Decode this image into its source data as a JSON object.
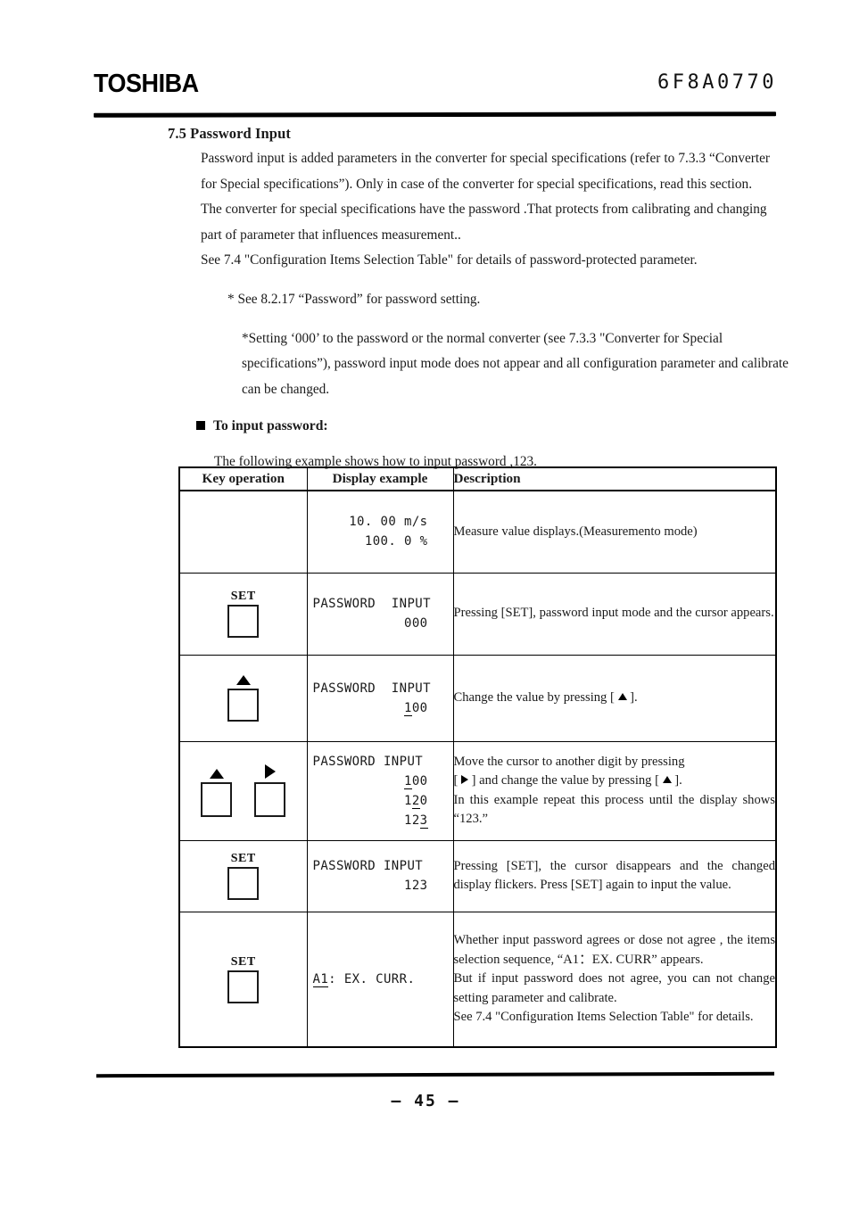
{
  "header": {
    "logo": "TOSHIBA",
    "doc_number": "6F8A0770"
  },
  "section": {
    "title": "7.5 Password Input",
    "paragraphs": [
      "Password input is added parameters in the converter for special specifications (refer to 7.3.3 “Converter for Special specifications”). Only in case of the converter for special specifications, read this section.",
      "The converter for special specifications have the password .That protects from calibrating and changing part of parameter that influences measurement..",
      "See 7.4 \"Configuration Items Selection Table\" for details of password-protected parameter."
    ],
    "notes": [
      "* See 8.2.17 “Password” for password setting.",
      "*Setting ‘000’ to the password or the normal converter (see 7.3.3 \"Converter for Special specifications”), password input mode does not appear and all configuration parameter and calibrate can be changed."
    ],
    "bullet_heading": "To input password:",
    "lead_in": "The following example shows how to input password ,123."
  },
  "table": {
    "headers": {
      "key_operation": "Key operation",
      "display_example": "Display example",
      "description": "Description"
    },
    "rows": [
      {
        "keys": [],
        "display_lines": [
          "10. 00 m/s",
          "100. 0 %"
        ],
        "description": "Measure value displays.(Measuremento mode)"
      },
      {
        "keys": [
          {
            "label": "SET",
            "icon": "set-key"
          }
        ],
        "display_lines": [
          "PASSWORD  INPUT",
          "000"
        ],
        "description": "Pressing [SET], password input mode and the cursor appears."
      },
      {
        "keys": [
          {
            "label": "",
            "icon": "arrow-up-key"
          }
        ],
        "display_lines": [
          "PASSWORD  INPUT",
          "100"
        ],
        "description_parts": [
          "Change the value by pressing [ ",
          " ]."
        ],
        "description": "Change the value by pressing [ ▲ ]."
      },
      {
        "keys": [
          {
            "label": "",
            "icon": "arrow-up-key"
          },
          {
            "label": "",
            "icon": "arrow-right-key"
          }
        ],
        "display_lines": [
          "PASSWORD INPUT",
          "100",
          "120",
          "123"
        ],
        "description": "Move the cursor to another digit by pressing [ ▶ ] and change the value by pressing [ ▲ ]. In this example repeat this process until the display shows “123.”"
      },
      {
        "keys": [
          {
            "label": "SET",
            "icon": "set-key"
          }
        ],
        "display_lines": [
          "PASSWORD INPUT",
          "123"
        ],
        "description": "Pressing [SET], the cursor disappears and the changed display flickers. Press [SET] again to input the value."
      },
      {
        "keys": [
          {
            "label": "SET",
            "icon": "set-key"
          }
        ],
        "display_lines": [
          "A1: EX. CURR."
        ],
        "description": "Whether input password agrees or dose not agree , the items selection sequence, “A1：EX. CURR” appears.\nBut if input password does not agree, you can not change setting parameter and calibrate.\nSee 7.4 \"Configuration Items Selection Table\" for details."
      }
    ],
    "row4_desc_line1": "Move the cursor to another digit by pressing",
    "row4_desc_line2a": "[ ",
    "row4_desc_line2b": " ] and change the value by pressing [ ",
    "row4_desc_line2c": " ].",
    "row4_desc_line3": "In this example repeat this process until the display shows “123.”",
    "row6_desc_p1": "Whether input password agrees or dose not agree , the items selection sequence, “A1：EX. CURR” appears.",
    "row6_desc_p2": "But if input password does not agree, you can not change setting parameter and calibrate.",
    "row6_desc_p3": "See 7.4 \"Configuration Items Selection Table\" for details."
  },
  "footer": {
    "page_number": "—  45  —"
  }
}
